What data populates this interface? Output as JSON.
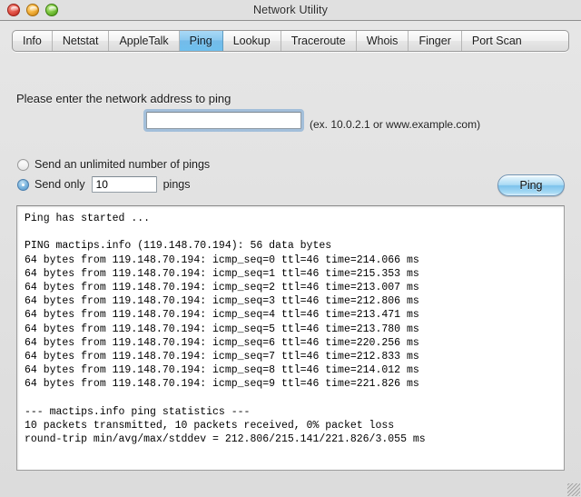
{
  "window": {
    "title": "Network Utility",
    "controls": {
      "close": "close",
      "minimize": "minimize",
      "zoom": "zoom"
    }
  },
  "tabs": [
    {
      "label": "Info",
      "selected": false
    },
    {
      "label": "Netstat",
      "selected": false
    },
    {
      "label": "AppleTalk",
      "selected": false
    },
    {
      "label": "Ping",
      "selected": true
    },
    {
      "label": "Lookup",
      "selected": false
    },
    {
      "label": "Traceroute",
      "selected": false
    },
    {
      "label": "Whois",
      "selected": false
    },
    {
      "label": "Finger",
      "selected": false
    },
    {
      "label": "Port Scan",
      "selected": false
    }
  ],
  "form": {
    "prompt": "Please enter the network address to ping",
    "address_value": "",
    "address_placeholder": "",
    "hint": "(ex. 10.0.2.1 or www.example.com)",
    "radio_unlimited_label": "Send an unlimited number of pings",
    "radio_unlimited_selected": false,
    "radio_limited_label_before": "Send only",
    "radio_limited_label_after": "pings",
    "radio_limited_selected": true,
    "count_value": "10",
    "ping_button_label": "Ping"
  },
  "output": {
    "text": "Ping has started ...\n\nPING mactips.info (119.148.70.194): 56 data bytes\n64 bytes from 119.148.70.194: icmp_seq=0 ttl=46 time=214.066 ms\n64 bytes from 119.148.70.194: icmp_seq=1 ttl=46 time=215.353 ms\n64 bytes from 119.148.70.194: icmp_seq=2 ttl=46 time=213.007 ms\n64 bytes from 119.148.70.194: icmp_seq=3 ttl=46 time=212.806 ms\n64 bytes from 119.148.70.194: icmp_seq=4 ttl=46 time=213.471 ms\n64 bytes from 119.148.70.194: icmp_seq=5 ttl=46 time=213.780 ms\n64 bytes from 119.148.70.194: icmp_seq=6 ttl=46 time=220.256 ms\n64 bytes from 119.148.70.194: icmp_seq=7 ttl=46 time=212.833 ms\n64 bytes from 119.148.70.194: icmp_seq=8 ttl=46 time=214.012 ms\n64 bytes from 119.148.70.194: icmp_seq=9 ttl=46 time=221.826 ms\n\n--- mactips.info ping statistics ---\n10 packets transmitted, 10 packets received, 0% packet loss\nround-trip min/avg/max/stddev = 212.806/215.141/221.826/3.055 ms",
    "host": "mactips.info",
    "ip": "119.148.70.194",
    "data_bytes": "56",
    "replies": [
      {
        "seq": "0",
        "ttl": "46",
        "time": "214.066"
      },
      {
        "seq": "1",
        "ttl": "46",
        "time": "215.353"
      },
      {
        "seq": "2",
        "ttl": "46",
        "time": "213.007"
      },
      {
        "seq": "3",
        "ttl": "46",
        "time": "212.806"
      },
      {
        "seq": "4",
        "ttl": "46",
        "time": "213.471"
      },
      {
        "seq": "5",
        "ttl": "46",
        "time": "213.780"
      },
      {
        "seq": "6",
        "ttl": "46",
        "time": "220.256"
      },
      {
        "seq": "7",
        "ttl": "46",
        "time": "212.833"
      },
      {
        "seq": "8",
        "ttl": "46",
        "time": "214.012"
      },
      {
        "seq": "9",
        "ttl": "46",
        "time": "221.826"
      }
    ],
    "stats": {
      "transmitted": "10",
      "received": "10",
      "loss": "0%",
      "min": "212.806",
      "avg": "215.141",
      "max": "221.826",
      "stddev": "3.055"
    }
  },
  "colors": {
    "selected_tab": "#8cc9ef",
    "ping_button": "#a9daf4",
    "focus_ring": "#7aa8d4",
    "window_chrome": "#e0e0e0"
  }
}
